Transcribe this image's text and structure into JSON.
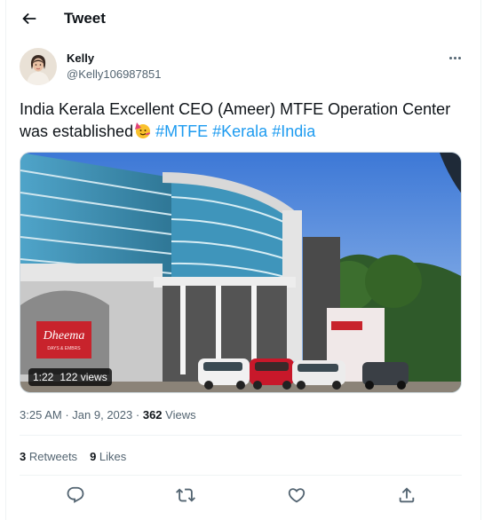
{
  "header": {
    "title": "Tweet"
  },
  "author": {
    "name": "Kelly",
    "handle": "@Kelly106987851"
  },
  "tweet": {
    "text_main": "India Kerala Excellent CEO (Ameer) MTFE Operation Center was established",
    "hashtags": [
      "#MTFE",
      "#Kerala",
      "#India"
    ]
  },
  "media": {
    "duration": "1:22",
    "views": "122 views",
    "sign_text": "Dheema",
    "sign_sub": "DAYS & EMBRS"
  },
  "meta": {
    "time": "3:25 AM",
    "separator": "·",
    "date": "Jan 9, 2023",
    "views_count": "362",
    "views_label": "Views"
  },
  "stats": {
    "retweets_count": "3",
    "retweets_label": "Retweets",
    "likes_count": "9",
    "likes_label": "Likes"
  },
  "icons": {
    "back": "arrow-left-icon",
    "more": "ellipsis-icon",
    "reply": "reply-icon",
    "retweet": "retweet-icon",
    "like": "heart-icon",
    "share": "share-icon"
  },
  "colors": {
    "link": "#1d9bf0",
    "text": "#0f1419",
    "secondary": "#536471"
  }
}
